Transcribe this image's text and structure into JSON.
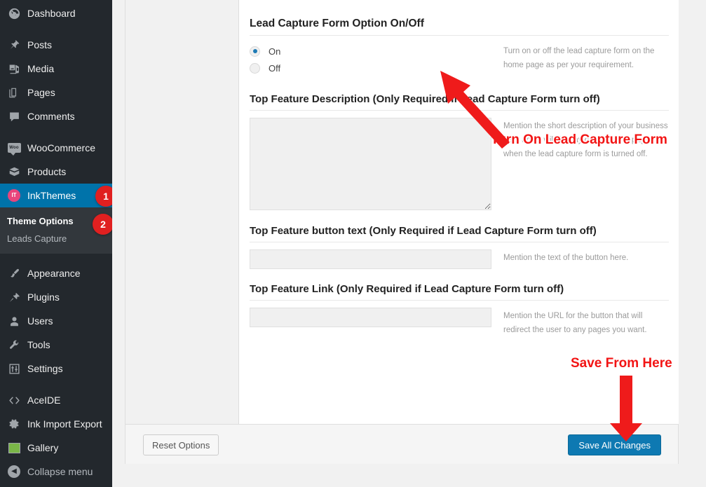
{
  "sidebar": {
    "items": [
      {
        "label": "Dashboard",
        "icon": "dashboard-icon",
        "current": false
      },
      {
        "label": "Posts",
        "icon": "pin-icon",
        "current": false
      },
      {
        "label": "Media",
        "icon": "media-icon",
        "current": false
      },
      {
        "label": "Pages",
        "icon": "pages-icon",
        "current": false
      },
      {
        "label": "Comments",
        "icon": "comment-icon",
        "current": false
      },
      {
        "label": "WooCommerce",
        "icon": "woocommerce-icon",
        "current": false
      },
      {
        "label": "Products",
        "icon": "products-box-icon",
        "current": false
      },
      {
        "label": "InkThemes",
        "icon": "inkthemes-icon",
        "current": true
      },
      {
        "label": "Appearance",
        "icon": "paintbrush-icon",
        "current": false
      },
      {
        "label": "Plugins",
        "icon": "plug-icon",
        "current": false
      },
      {
        "label": "Users",
        "icon": "user-icon",
        "current": false
      },
      {
        "label": "Tools",
        "icon": "wrench-icon",
        "current": false
      },
      {
        "label": "Settings",
        "icon": "sliders-icon",
        "current": false
      },
      {
        "label": "AceIDE",
        "icon": "code-brackets-icon",
        "current": false
      },
      {
        "label": "Ink Import Export",
        "icon": "gear-icon",
        "current": false
      },
      {
        "label": "Gallery",
        "icon": "gallery-icon",
        "current": false
      },
      {
        "label": "Collapse menu",
        "icon": "collapse-arrow-icon",
        "current": false
      }
    ],
    "submenu": [
      {
        "label": "Theme Options",
        "current": true
      },
      {
        "label": "Leads Capture",
        "current": false
      }
    ],
    "badges": [
      {
        "value": "1",
        "target": "InkThemes"
      },
      {
        "value": "2",
        "target": "Theme Options"
      }
    ],
    "woo_glyph_text": "Woo",
    "ink_glyph_text": "IT",
    "collapse_glyph": "◀",
    "colors": {
      "menu_bg": "#23282d",
      "submenu_bg": "#32373c",
      "current_bg": "#0073aa",
      "badge_bg": "#e02020"
    }
  },
  "panel": {
    "top_textarea": {
      "value": "",
      "placeholder": ""
    },
    "sections": [
      {
        "title": "Lead Capture Form Option On/Off",
        "type": "radio",
        "explanation": "Turn on or off the lead capture form on the home page as per your requirement.",
        "options": [
          {
            "label": "On",
            "checked": true
          },
          {
            "label": "Off",
            "checked": false
          }
        ]
      },
      {
        "title": "Top Feature Description (Only Required if Lead Capture Form turn off)",
        "type": "textarea",
        "value": "",
        "placeholder": "",
        "explanation": "Mention the short description of your business here and it will display on the home page when the lead capture form is turned off."
      },
      {
        "title": "Top Feature button text (Only Required if Lead Capture Form turn off)",
        "type": "text",
        "value": "",
        "placeholder": "",
        "explanation": "Mention the text of the button here."
      },
      {
        "title": "Top Feature Link (Only Required if Lead Capture Form turn off)",
        "type": "text",
        "value": "",
        "placeholder": "",
        "explanation": "Mention the URL for the button that will redirect the user to any pages you want."
      }
    ],
    "footer": {
      "reset_label": "Reset Options",
      "save_label": "Save All Changes",
      "save_color": "#0e79b2"
    }
  },
  "annotations": {
    "color": "#f21414",
    "items": [
      {
        "text": "Turn On Lead Capture Form",
        "name": "annotation-turn-on"
      },
      {
        "text": "Save From Here",
        "name": "annotation-save-from-here"
      }
    ],
    "arrows": [
      {
        "name": "annotation-arrow-up-left",
        "points_to": "Lead Capture Form Option On/Off heading"
      },
      {
        "name": "annotation-arrow-down",
        "points_to": "Save All Changes button"
      }
    ]
  }
}
